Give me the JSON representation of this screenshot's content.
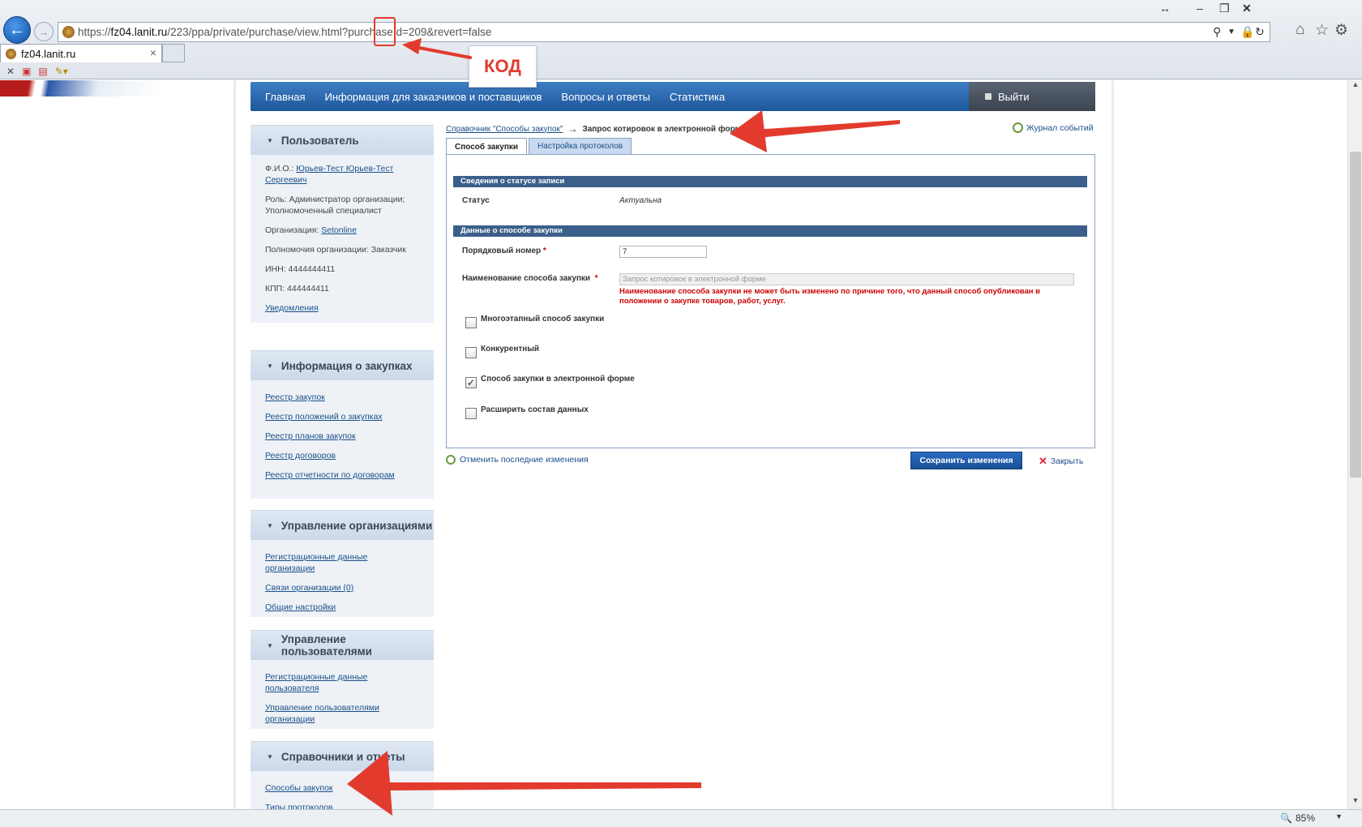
{
  "browser": {
    "url": {
      "prefix": "https://",
      "domain": "fz04.lanit.ru",
      "rest": "/223/ppa/private/purchase/view.html?purchaseId=209&revert=false"
    },
    "tab_title": "fz04.lanit.ru",
    "annotation": "КОД",
    "zoom": "85%"
  },
  "menu": {
    "items": [
      "Главная",
      "Информация для заказчиков и поставщиков",
      "Вопросы и ответы",
      "Статистика"
    ],
    "logout": "Выйти"
  },
  "sidebar": {
    "user": {
      "title": "Пользователь",
      "fio_label": "Ф.И.О.:",
      "fio_value": "Юрьев-Тест Юрьев-Тест Сергеевич",
      "role": "Роль: Администратор организации; Уполномоченный специалист",
      "org_label": "Организация:",
      "org_value": "Setonline",
      "powers": "Полномочия организации: Заказчик",
      "inn": "ИНН: 4444444411",
      "kpp": "КПП: 444444411",
      "notifications": "Уведомления"
    },
    "purchases": {
      "title": "Информация о закупках",
      "links": [
        "Реестр закупок",
        "Реестр положений о закупках",
        "Реестр планов закупок",
        "Реестр договоров",
        "Реестр отчетности по договорам"
      ]
    },
    "orgs": {
      "title": "Управление организациями",
      "links": [
        "Регистрационные данные организации",
        "Связи организации (0)",
        "Общие настройки"
      ]
    },
    "users": {
      "title": "Управление пользователями",
      "links": [
        "Регистрационные данные пользователя",
        "Управление пользователями организации"
      ]
    },
    "refs": {
      "title": "Справочники и отчеты",
      "links": [
        "Способы закупок",
        "Типы протоколов"
      ]
    }
  },
  "breadcrumb": {
    "parent": "Справочник \"Способы закупок\"",
    "arrow": "→",
    "current": "Запрос котировок в электронной форме"
  },
  "journal": "Журнал событий",
  "tabs": [
    "Способ закупки",
    "Настройка протоколов"
  ],
  "form": {
    "status_section": "Сведения о статусе записи",
    "status_label": "Статус",
    "status_value": "Актуальна",
    "data_section": "Данные о способе закупки",
    "number_label": "Порядковый номер",
    "number_value": "7",
    "name_label": "Наименование способа закупки",
    "name_value": "Запрос котировок в электронной форме",
    "error": "Наименование способа закупки не может быть изменено по причине того, что данный способ опубликован в положении о закупке товаров, работ, услуг.",
    "req": "*",
    "checkboxes": [
      {
        "label": "Многоэтапный способ закупки",
        "checked": false
      },
      {
        "label": "Конкурентный",
        "checked": false
      },
      {
        "label": "Способ закупки в электронной форме",
        "checked": true
      },
      {
        "label": "Расширить состав данных",
        "checked": false
      }
    ]
  },
  "actions": {
    "undo": "Отменить последние изменения",
    "save": "Сохранить изменения",
    "close": "Закрыть"
  }
}
